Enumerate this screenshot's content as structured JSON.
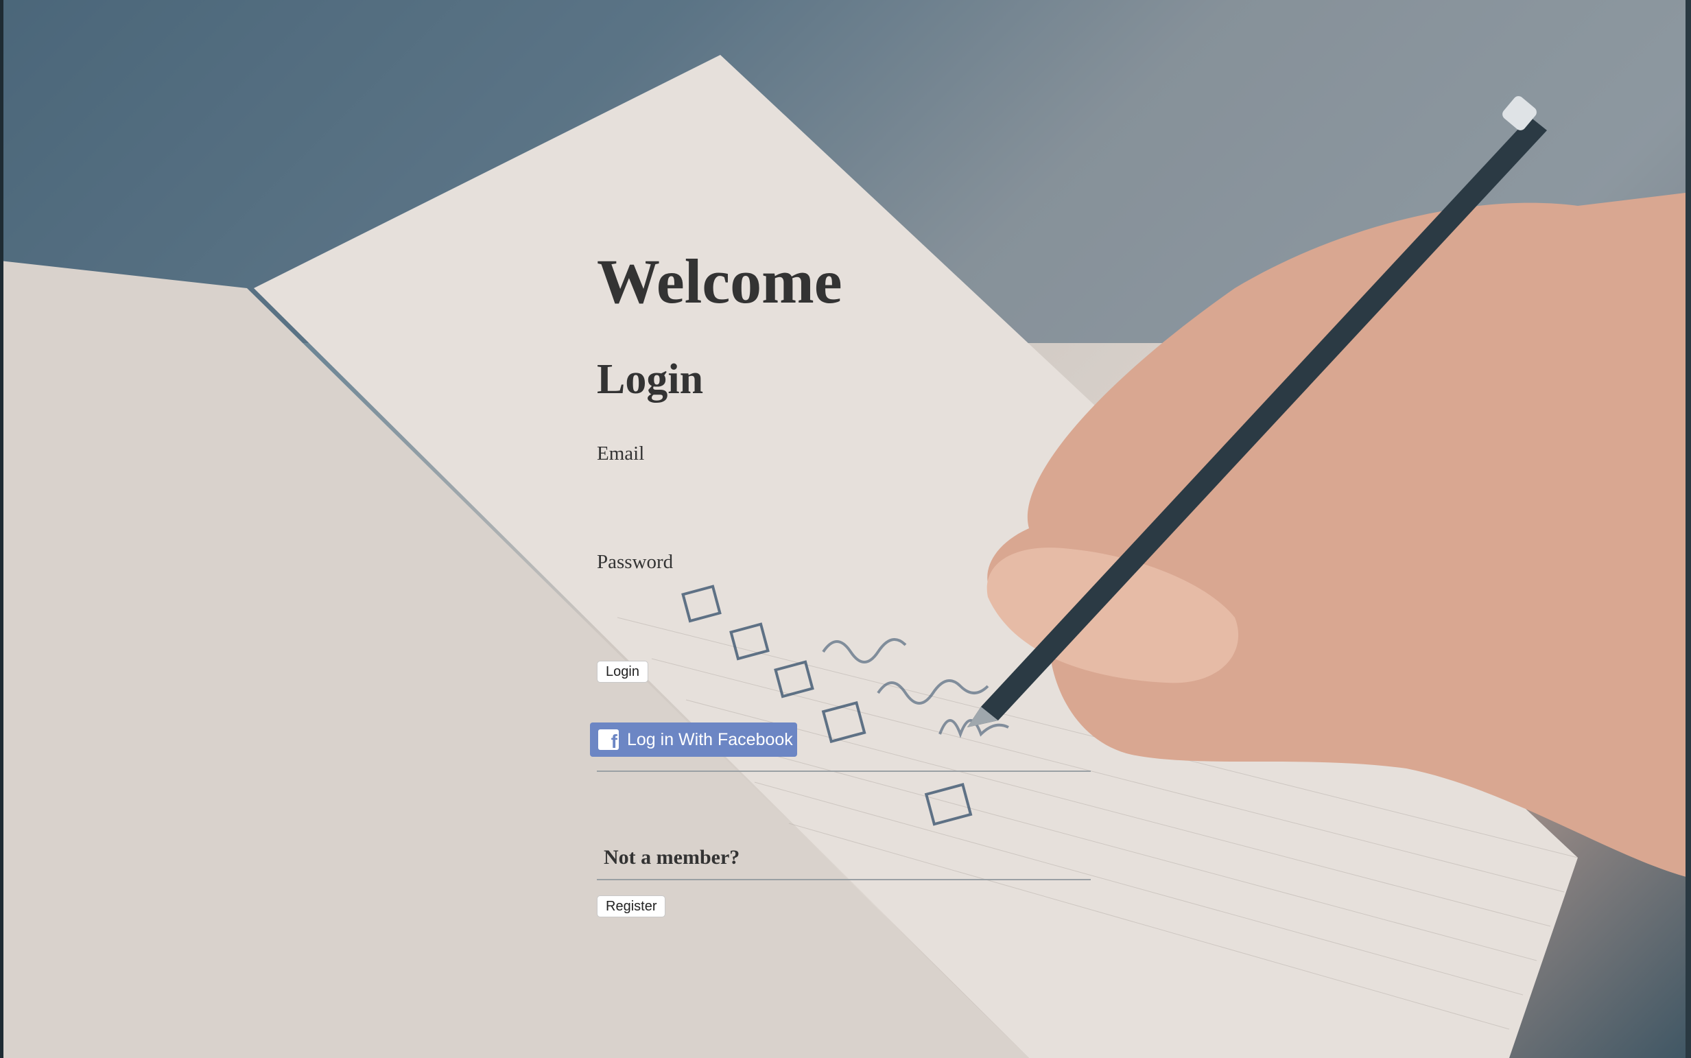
{
  "page": {
    "welcome_title": "Welcome",
    "login_heading": "Login"
  },
  "form": {
    "email_label": "Email",
    "email_value": "",
    "password_label": "Password",
    "password_value": "",
    "login_button": "Login",
    "facebook_button": "Log in With Facebook",
    "facebook_icon": "facebook-f-icon"
  },
  "register": {
    "prompt": "Not a member?",
    "button": "Register"
  },
  "colors": {
    "text": "#333333",
    "facebook_blue": "#6c86c4",
    "input_underline": "#9aa0a4"
  },
  "background": {
    "description_icon": "notebook-checklist-photo"
  }
}
